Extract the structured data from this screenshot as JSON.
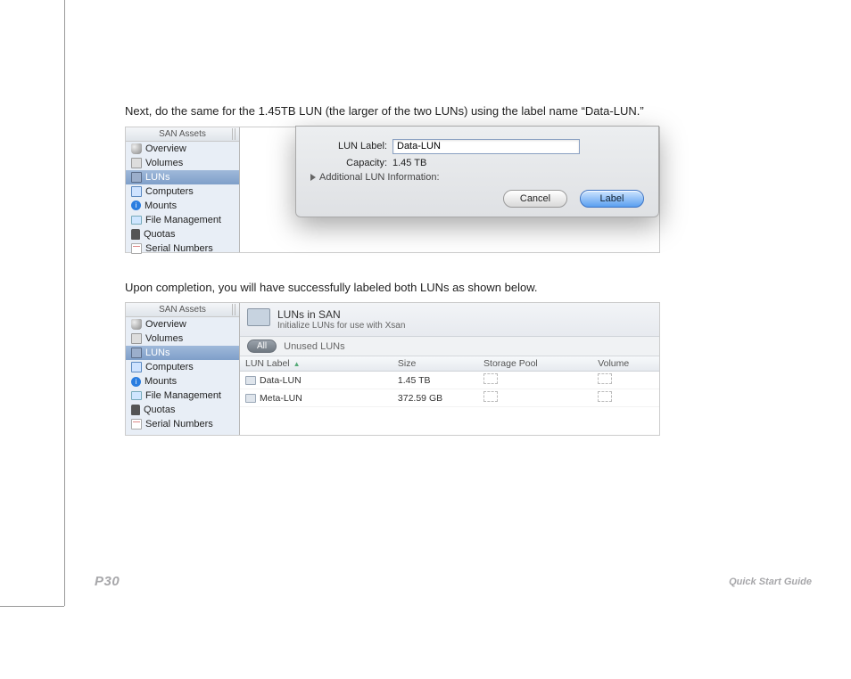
{
  "page": {
    "instruction1": "Next, do the same for the 1.45TB LUN (the larger of the two LUNs) using the label name “Data-LUN.”",
    "instruction2": "Upon completion, you will have successfully labeled both LUNs as shown below.",
    "number": "P30",
    "guide": "Quick Start Guide"
  },
  "sidebar": {
    "header": "SAN Assets",
    "items": [
      {
        "label": "Overview"
      },
      {
        "label": "Volumes"
      },
      {
        "label": "LUNs"
      },
      {
        "label": "Computers"
      },
      {
        "label": "Mounts"
      },
      {
        "label": "File Management"
      },
      {
        "label": "Quotas"
      },
      {
        "label": "Serial Numbers"
      }
    ]
  },
  "dialog": {
    "labelFieldLabel": "LUN Label:",
    "labelFieldValue": "Data-LUN",
    "capacityLabel": "Capacity:",
    "capacityValue": "1.45 TB",
    "disclosure": "Additional LUN Information:",
    "cancel": "Cancel",
    "confirm": "Label",
    "bgColVolume": "Volume",
    "bgRow1Label": "Meta-LUN"
  },
  "lunsPane": {
    "titleIconName": "luns-big-icon",
    "title": "LUNs in SAN",
    "subtitle": "Initialize LUNs for use with Xsan",
    "filterAll": "All",
    "filterLabel": "Unused LUNs",
    "columns": {
      "label": "LUN Label",
      "size": "Size",
      "storagePool": "Storage Pool",
      "volume": "Volume"
    },
    "rows": [
      {
        "label": "Data-LUN",
        "size": "1.45 TB"
      },
      {
        "label": "Meta-LUN",
        "size": "372.59 GB"
      }
    ]
  }
}
